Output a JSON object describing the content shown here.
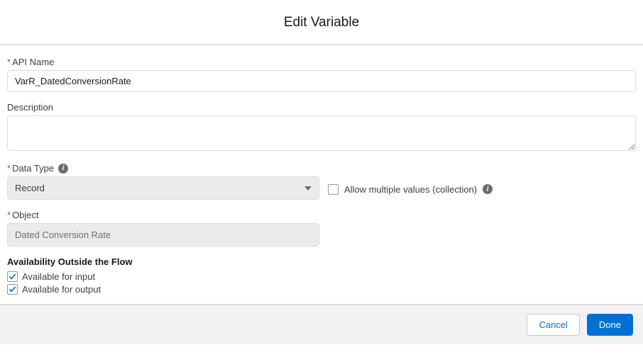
{
  "dialog": {
    "title": "Edit Variable"
  },
  "fields": {
    "apiName": {
      "label": "API Name",
      "value": "VarR_DatedConversionRate"
    },
    "description": {
      "label": "Description",
      "value": ""
    },
    "dataType": {
      "label": "Data Type",
      "value": "Record"
    },
    "allowMultiple": {
      "label": "Allow multiple values (collection)",
      "checked": false
    },
    "object": {
      "label": "Object",
      "value": "Dated Conversion Rate"
    }
  },
  "availability": {
    "heading": "Availability Outside the Flow",
    "input": {
      "label": "Available for input",
      "checked": true
    },
    "output": {
      "label": "Available for output",
      "checked": true
    }
  },
  "footer": {
    "cancel": "Cancel",
    "done": "Done"
  }
}
